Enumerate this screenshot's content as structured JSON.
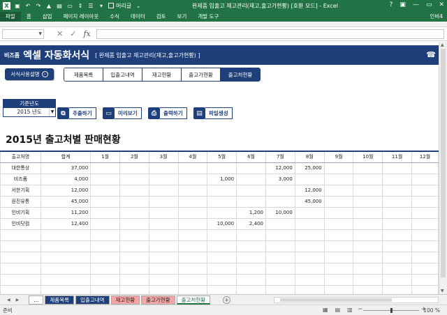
{
  "window": {
    "title": "완제품 입출고 재고관리(재고,출고가현황) [호환 모드] - Excel",
    "checkbox_label": "머리글",
    "user": "인비4",
    "controls": [
      "?",
      "▣",
      "—",
      "▭",
      "✕"
    ]
  },
  "ribbon": {
    "tabs": [
      "파일",
      "홈",
      "삽입",
      "페이지 레이아웃",
      "수식",
      "데이터",
      "검토",
      "보기",
      "개발 도구"
    ]
  },
  "formula_bar": {
    "name_box": "",
    "cancel": "✕",
    "enter": "✓",
    "fx": "fx",
    "value": ""
  },
  "banner": {
    "brand": "비즈폼",
    "title": "엑셀 자동화서식",
    "subtitle": "[ 완제품 입출고 재고관리(재고,출고가현황) ]",
    "phone_icon": "☎"
  },
  "help_button": "서식사용설명",
  "nav_tabs": [
    "제품목록",
    "입출고내역",
    "재고현황",
    "출고가현황",
    "출고처현황"
  ],
  "nav_active": 4,
  "year": {
    "label": "기준년도",
    "value": "2015 년도"
  },
  "actions": [
    {
      "label": "추출하기",
      "icon": "extract-icon",
      "glyph": "⧉"
    },
    {
      "label": "미리보기",
      "icon": "preview-icon",
      "glyph": "▭"
    },
    {
      "label": "출력하기",
      "icon": "print-icon",
      "glyph": "⎙"
    },
    {
      "label": "파일생성",
      "icon": "folder-icon",
      "glyph": "▤"
    }
  ],
  "heading": "2015년 출고처별 판매현황",
  "table": {
    "headers": [
      "출고처명",
      "합계",
      "1월",
      "2월",
      "3월",
      "4월",
      "5월",
      "6월",
      "7월",
      "8월",
      "9월",
      "10월",
      "11월",
      "12월"
    ],
    "rows": [
      [
        "대한통상",
        "37,000",
        "",
        "",
        "",
        "",
        "",
        "",
        "12,000",
        "25,000",
        "",
        "",
        "",
        ""
      ],
      [
        "비즈폼",
        "4,000",
        "",
        "",
        "",
        "",
        "1,000",
        "",
        "3,000",
        "",
        "",
        "",
        "",
        ""
      ],
      [
        "서한기획",
        "12,000",
        "",
        "",
        "",
        "",
        "",
        "",
        "",
        "12,000",
        "",
        "",
        "",
        ""
      ],
      [
        "원진유통",
        "45,000",
        "",
        "",
        "",
        "",
        "",
        "",
        "",
        "45,000",
        "",
        "",
        "",
        ""
      ],
      [
        "인비기획",
        "11,200",
        "",
        "",
        "",
        "",
        "",
        "1,200",
        "10,000",
        "",
        "",
        "",
        "",
        ""
      ],
      [
        "인비닷컴",
        "12,400",
        "",
        "",
        "",
        "",
        "10,000",
        "2,400",
        "",
        "",
        "",
        "",
        "",
        ""
      ],
      [
        "",
        "",
        "",
        "",
        "",
        "",
        "",
        "",
        "",
        "",
        "",
        "",
        "",
        ""
      ],
      [
        "",
        "",
        "",
        "",
        "",
        "",
        "",
        "",
        "",
        "",
        "",
        "",
        "",
        ""
      ],
      [
        "",
        "",
        "",
        "",
        "",
        "",
        "",
        "",
        "",
        "",
        "",
        "",
        "",
        ""
      ],
      [
        "",
        "",
        "",
        "",
        "",
        "",
        "",
        "",
        "",
        "",
        "",
        "",
        "",
        ""
      ],
      [
        "",
        "",
        "",
        "",
        "",
        "",
        "",
        "",
        "",
        "",
        "",
        "",
        "",
        ""
      ],
      [
        "",
        "",
        "",
        "",
        "",
        "",
        "",
        "",
        "",
        "",
        "",
        "",
        "",
        ""
      ],
      [
        "",
        "",
        "",
        "",
        "",
        "",
        "",
        "",
        "",
        "",
        "",
        "",
        "",
        ""
      ],
      [
        "",
        "",
        "",
        "",
        "",
        "",
        "",
        "",
        "",
        "",
        "",
        "",
        "",
        ""
      ],
      [
        "",
        "",
        "",
        "",
        "",
        "",
        "",
        "",
        "",
        "",
        "",
        "",
        "",
        ""
      ]
    ]
  },
  "sheet_tabs": [
    {
      "label": "...",
      "style": "dots"
    },
    {
      "label": "제품목록",
      "style": "navy"
    },
    {
      "label": "입출고내역",
      "style": "navy"
    },
    {
      "label": "재고현황",
      "style": "pink"
    },
    {
      "label": "출고가현황",
      "style": "pink"
    },
    {
      "label": "출고처현황",
      "style": "cur"
    }
  ],
  "add_sheet": "+",
  "status": {
    "ready": "준비",
    "zoom": "100 %",
    "zoom_level": 1.0
  },
  "colors": {
    "excel_green": "#217346",
    "navy": "#1f3f7a",
    "pink_tab": "#f4a6a6"
  }
}
